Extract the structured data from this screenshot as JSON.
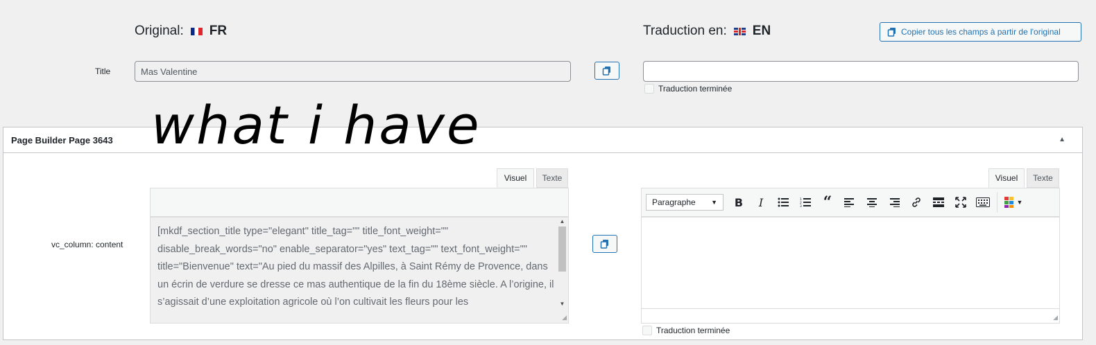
{
  "header": {
    "original_label": "Original:",
    "original_code": "FR",
    "translation_label": "Traduction en:",
    "translation_code": "EN",
    "copy_all_label": "Copier tous les champs à partir de l'original"
  },
  "title_field": {
    "label": "Title",
    "original_value": "Mas Valentine",
    "translation_value": "",
    "done_label": "Traduction terminée"
  },
  "overlay_text": "what i have",
  "panel": {
    "title": "Page Builder Page 3643"
  },
  "content_field": {
    "label": "vc_column: content",
    "tabs": [
      "Visuel",
      "Texte"
    ],
    "original_text": "[mkdf_section_title type=\"elegant\" title_tag=\"\" title_font_weight=\"\" disable_break_words=\"no\" enable_separator=\"yes\" text_tag=\"\" text_font_weight=\"\" title=\"Bienvenue\" text=\"Au pied du massif des Alpilles, à Saint Rémy de Provence, dans un écrin de verdure se dresse ce mas authentique de la fin du 18ème siècle. A l’origine, il s’agissait d’une exploitation agricole où l’on cultivait les fleurs pour les",
    "format_select": "Paragraphe",
    "done_label": "Traduction terminée"
  },
  "colors": {
    "accent": "#2271b1",
    "background": "#f0f0f1"
  }
}
